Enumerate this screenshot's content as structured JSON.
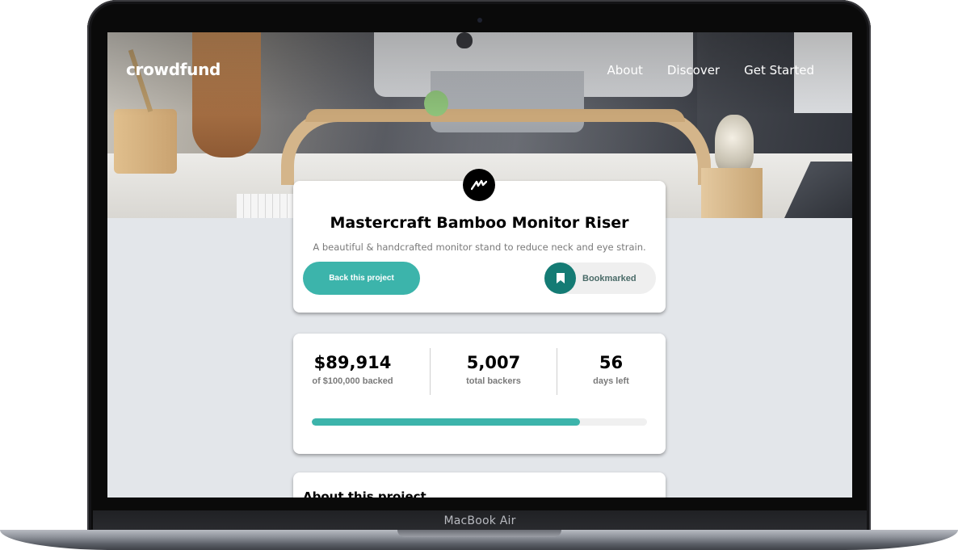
{
  "device": {
    "label": "MacBook Air"
  },
  "nav": {
    "logo": "crowdfund",
    "links": [
      "About",
      "Discover",
      "Get Started"
    ]
  },
  "project": {
    "title": "Mastercraft Bamboo Monitor Riser",
    "description": "A beautiful & handcrafted monitor stand to reduce neck and eye strain.",
    "back_button": "Back this project",
    "bookmark_button": "Bookmarked"
  },
  "stats": {
    "backed": {
      "value": "$89,914",
      "label": "of $100,000 backed"
    },
    "backers": {
      "value": "5,007",
      "label": "total backers"
    },
    "days": {
      "value": "56",
      "label": "days left"
    },
    "progress_percent": 80
  },
  "about": {
    "title": "About this project"
  },
  "colors": {
    "accent": "#3cb4ab",
    "accent_dark": "#147b74",
    "page_bg": "#e3e6ea"
  }
}
